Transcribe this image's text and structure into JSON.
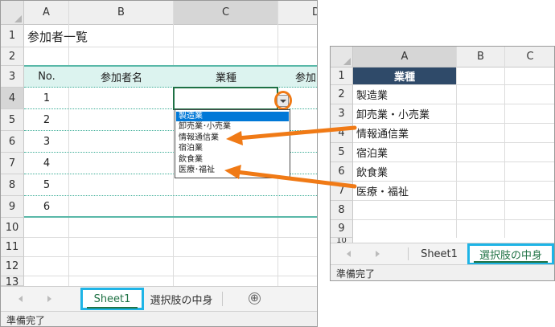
{
  "main_sheet": {
    "columns": [
      "A",
      "B",
      "C",
      "D"
    ],
    "rows": [
      "1",
      "2",
      "3",
      "4",
      "5",
      "6",
      "7",
      "8",
      "9",
      "10",
      "11",
      "12",
      "13"
    ],
    "title": "参加者一覧",
    "headers": {
      "no": "No.",
      "name": "参加者名",
      "industry": "業種",
      "cut": "参加"
    },
    "numbers": [
      "1",
      "2",
      "3",
      "4",
      "5",
      "6"
    ],
    "dropdown_options": [
      "製造業",
      "卸売業･小売業",
      "情報通信業",
      "宿泊業",
      "飲食業",
      "医療･福祉"
    ],
    "tabs": [
      "Sheet1",
      "選択肢の中身"
    ],
    "add_sheet": "⊕",
    "status": "準備完了"
  },
  "list_sheet": {
    "columns": [
      "A",
      "B",
      "C"
    ],
    "rows": [
      "1",
      "2",
      "3",
      "4",
      "5",
      "6",
      "7",
      "8",
      "9",
      "10"
    ],
    "header": "業種",
    "values": [
      "製造業",
      "卸売業・小売業",
      "情報通信業",
      "宿泊業",
      "飲食業",
      "医療・福祉"
    ],
    "tabs": [
      "Sheet1",
      "選択肢の中身"
    ],
    "status": "準備完了"
  },
  "colors": {
    "accent_orange": "#f07a16",
    "tab_highlight": "#1eb4e6",
    "excel_green": "#217346",
    "header_navy": "#2f4a69",
    "band_teal": "#dcf3ef"
  }
}
